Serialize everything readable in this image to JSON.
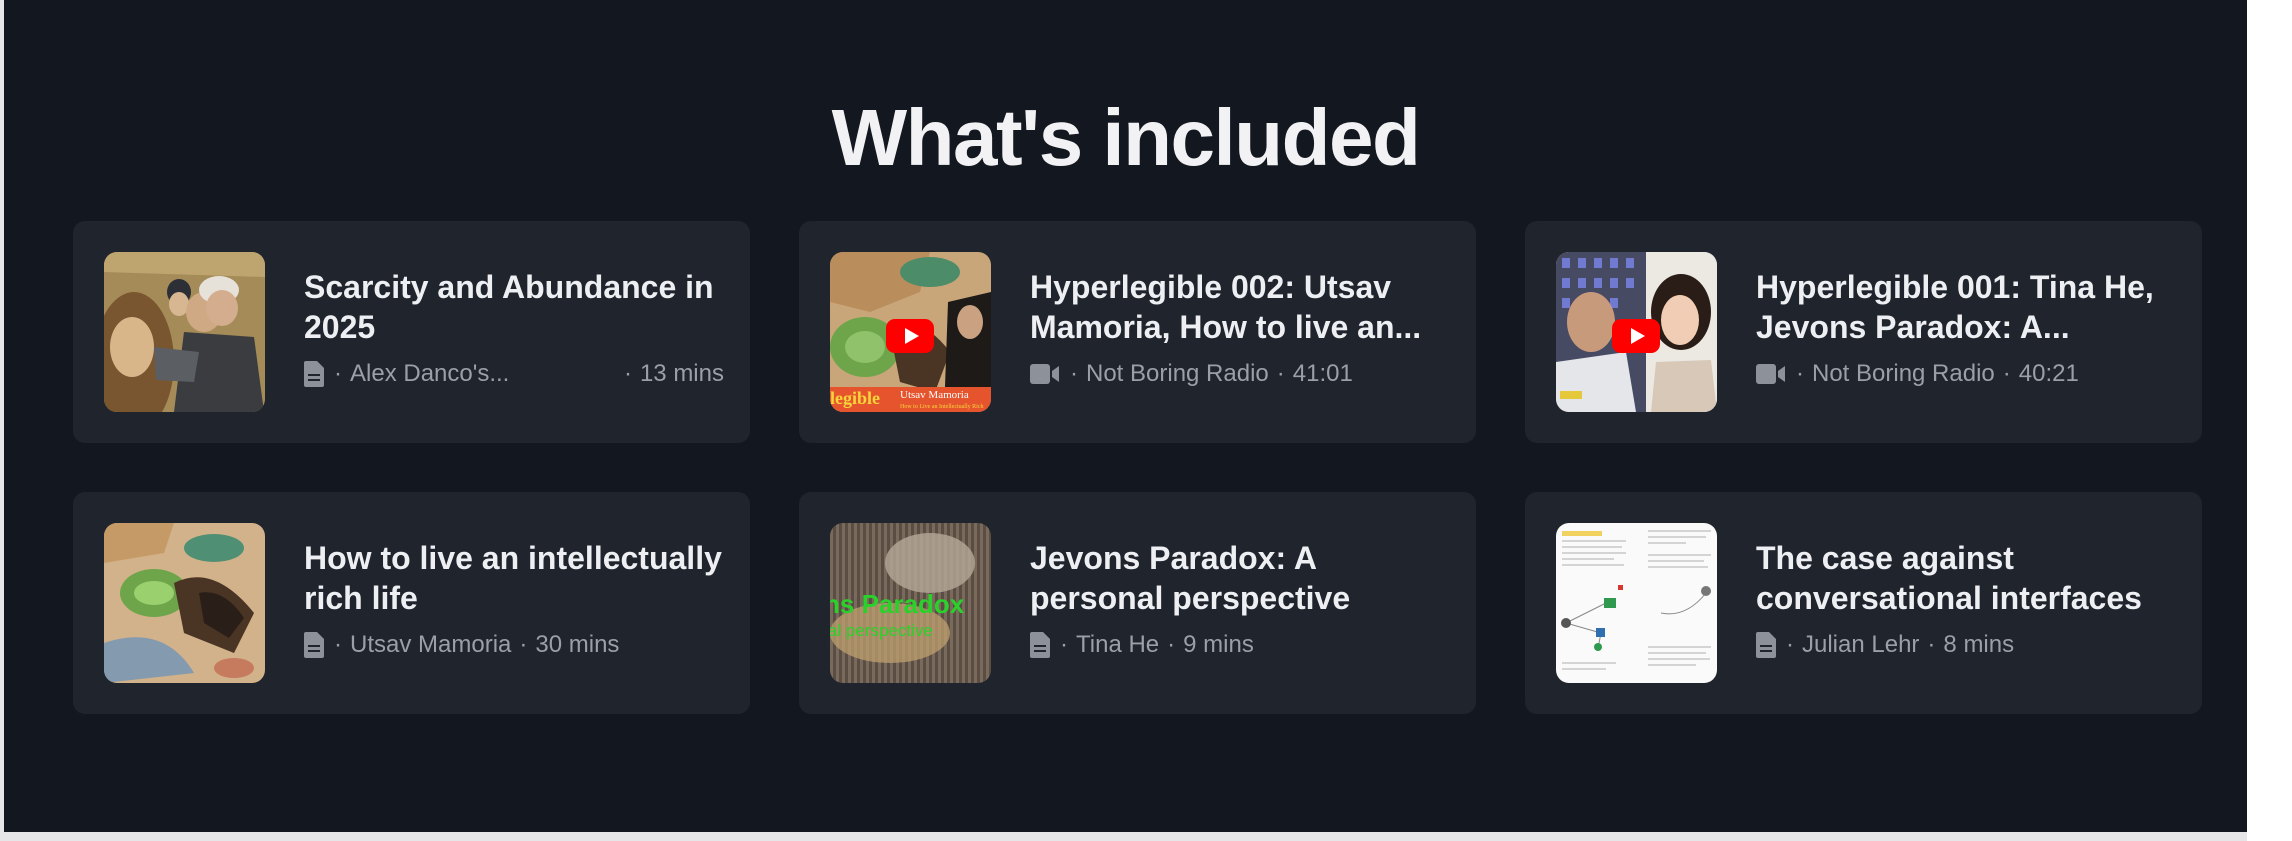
{
  "heading": "What's included",
  "items": [
    {
      "title": "Scarcity and Abundance in 2025",
      "type_icon": "document-icon",
      "author": "Alex Danco's...",
      "duration": "13 mins"
    },
    {
      "title": "Hyperlegible 002: Utsav Mamoria, How to live an...",
      "type_icon": "video-icon",
      "author": "Not Boring Radio",
      "duration": "41:01",
      "thumb_text": [
        "legible",
        "Utsav Mamoria",
        "How to Live an Intellectually Rich"
      ]
    },
    {
      "title": "Hyperlegible 001: Tina He, Jevons Paradox: A...",
      "type_icon": "video-icon",
      "author": "Not Boring Radio",
      "duration": "40:21"
    },
    {
      "title": "How to live an intellectually rich life",
      "type_icon": "document-icon",
      "author": "Utsav Mamoria",
      "duration": "30 mins"
    },
    {
      "title": "Jevons Paradox: A personal perspective",
      "type_icon": "document-icon",
      "author": "Tina He",
      "duration": "9 mins",
      "thumb_text": [
        "ns Paradox",
        "al perspective"
      ]
    },
    {
      "title": "The case against conversational interfaces",
      "type_icon": "document-icon",
      "author": "Julian Lehr",
      "duration": "8 mins"
    }
  ],
  "colors": {
    "background": "#13171f",
    "card": "#1f242d",
    "heading": "#f2f2f4",
    "meta": "#9b9fa8",
    "youtube_red": "#ff0000"
  }
}
